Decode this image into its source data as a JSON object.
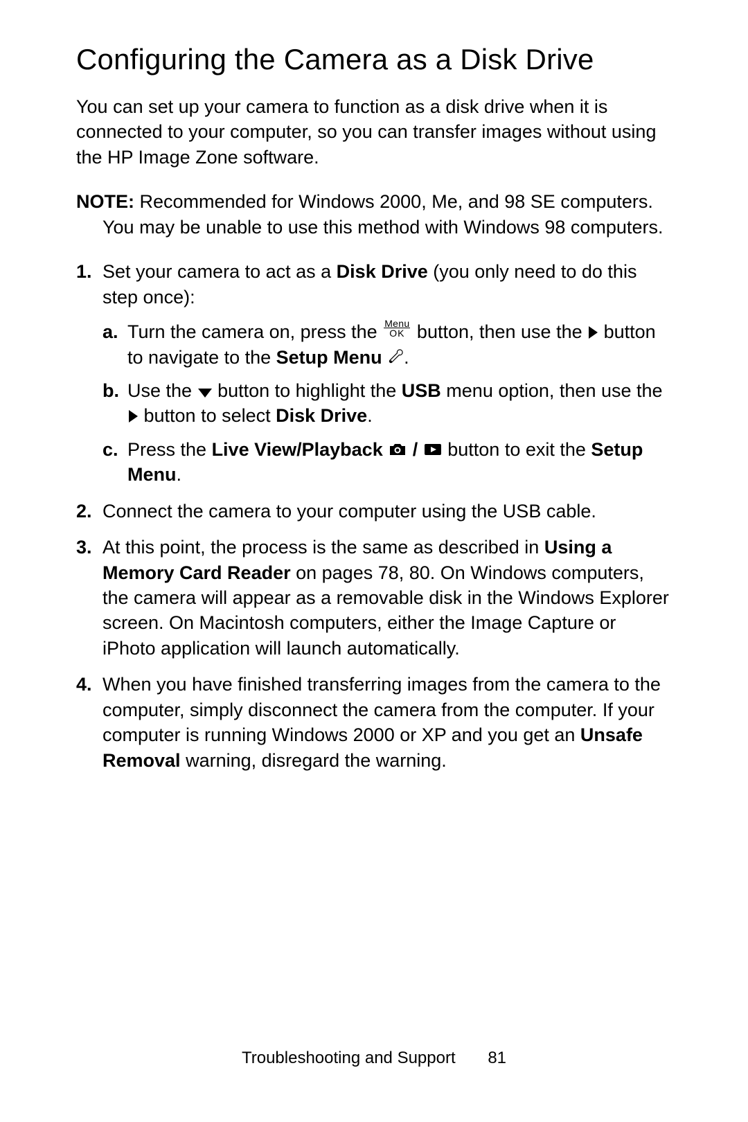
{
  "title": "Configuring the Camera as a Disk Drive",
  "intro": "You can set up your camera to function as a disk drive when it is connected to your computer, so you can transfer images without using the HP Image Zone software.",
  "note": {
    "label": "NOTE:",
    "text": " Recommended for Windows 2000, Me, and 98 SE computers. You may be unable to use this method with Windows 98 computers."
  },
  "steps": {
    "s1": {
      "lead": "Set your camera to act as a ",
      "bold1": "Disk Drive",
      "tail": " (you only need to do this step once):",
      "a": {
        "t1": "Turn the camera on, press the ",
        "t2": " button, then use the ",
        "t3": " button to navigate to the ",
        "bold": "Setup Menu",
        "t4": " ",
        "t5": "."
      },
      "b": {
        "t1": "Use the ",
        "t2": " button to highlight the ",
        "bold1": "USB",
        "t3": " menu option, then use the ",
        "t4": " button to select ",
        "bold2": "Disk Drive",
        "t5": "."
      },
      "c": {
        "t1": "Press the ",
        "bold1": "Live View/Playback",
        "t2": " ",
        "t3": " button to exit the ",
        "bold2": "Setup Menu",
        "t4": "."
      }
    },
    "s2": "Connect the camera to your computer using the USB cable.",
    "s3": {
      "t1": "At this point, the process is the same as described in ",
      "bold1": "Using a Memory Card Reader",
      "t2": " on pages 78, 80. On Windows computers, the camera will appear as a removable disk in the Windows Explorer screen. On Macintosh computers, either the Image Capture or iPhoto application will launch automatically."
    },
    "s4": {
      "t1": "When you have finished transferring images from the camera to the computer, simply disconnect the camera from the computer. If your computer is running Windows 2000 or XP and you get an ",
      "bold1": "Unsafe Removal",
      "t2": " warning, disregard the warning."
    }
  },
  "menu_ok": {
    "top": "Menu",
    "bottom": "OK"
  },
  "footer": {
    "section": "Troubleshooting and Support",
    "page": "81"
  }
}
